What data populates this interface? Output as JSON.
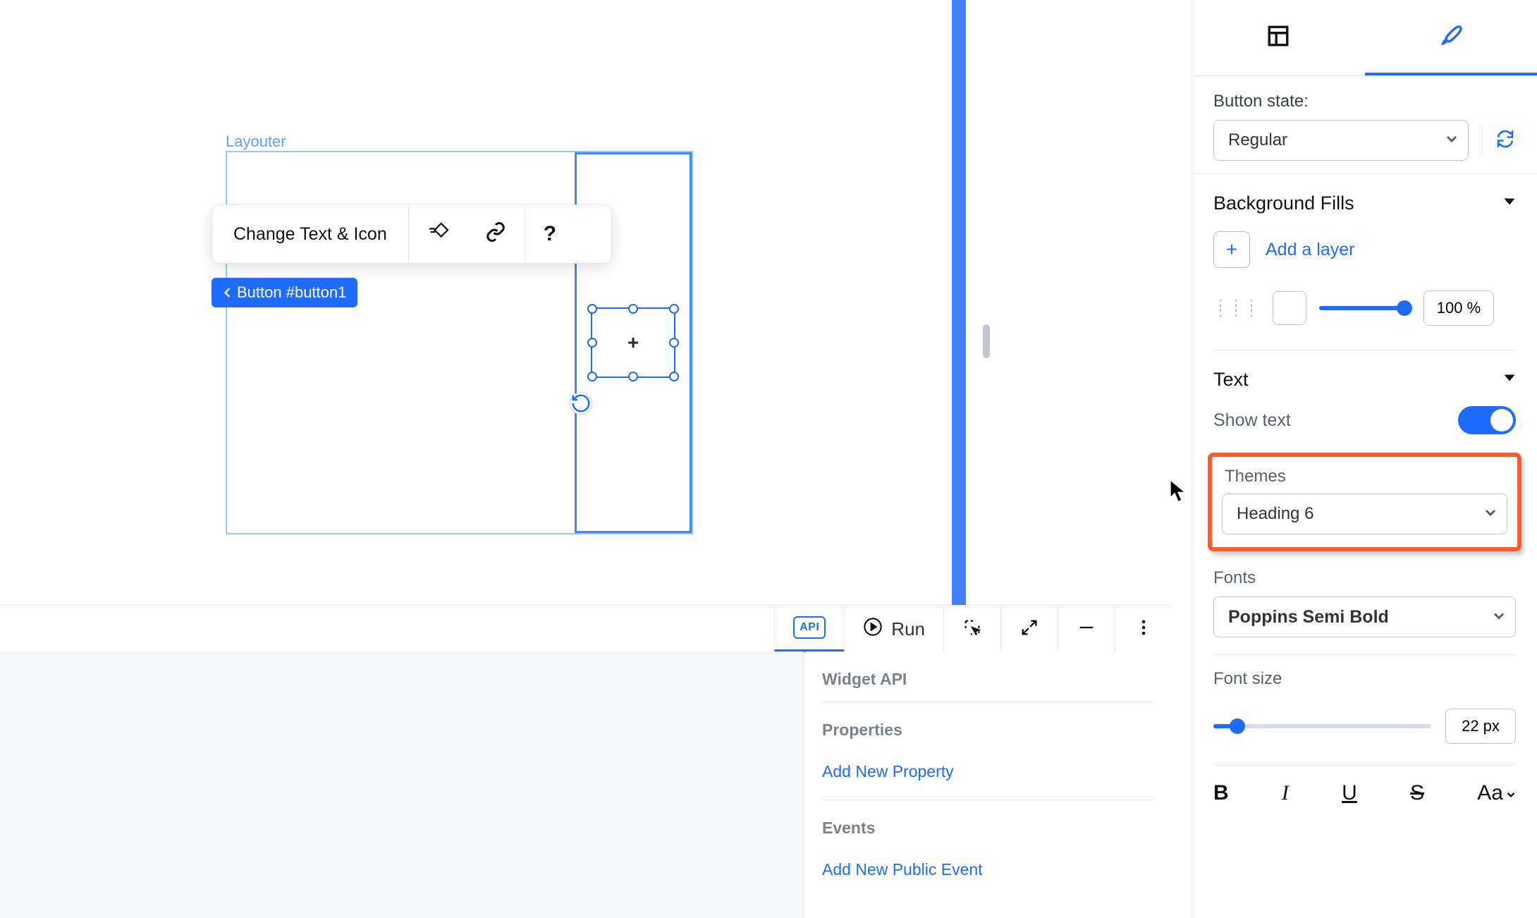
{
  "canvas": {
    "layouter_label": "Layouter",
    "toolbar": {
      "change_text_icon": "Change Text & Icon"
    },
    "selection_chip": "Button #button1",
    "plus_glyph": "+"
  },
  "bottom": {
    "api_label": "API",
    "run_label": "Run"
  },
  "api_panel": {
    "widget_api": "Widget API",
    "properties": "Properties",
    "add_property": "Add New Property",
    "events": "Events",
    "add_event": "Add New Public Event"
  },
  "right": {
    "button_state_label": "Button state:",
    "button_state_value": "Regular",
    "bg_fills_header": "Background Fills",
    "add_layer": "Add a layer",
    "opacity_value": "100 %",
    "text_header": "Text",
    "show_text_label": "Show text",
    "themes_label": "Themes",
    "themes_value": "Heading 6",
    "fonts_label": "Fonts",
    "fonts_value": "Poppins Semi Bold",
    "font_size_label": "Font size",
    "font_size_value": "22 px",
    "fmt": {
      "b": "B",
      "i": "I",
      "u": "U",
      "s": "S",
      "aa": "Aa"
    }
  }
}
